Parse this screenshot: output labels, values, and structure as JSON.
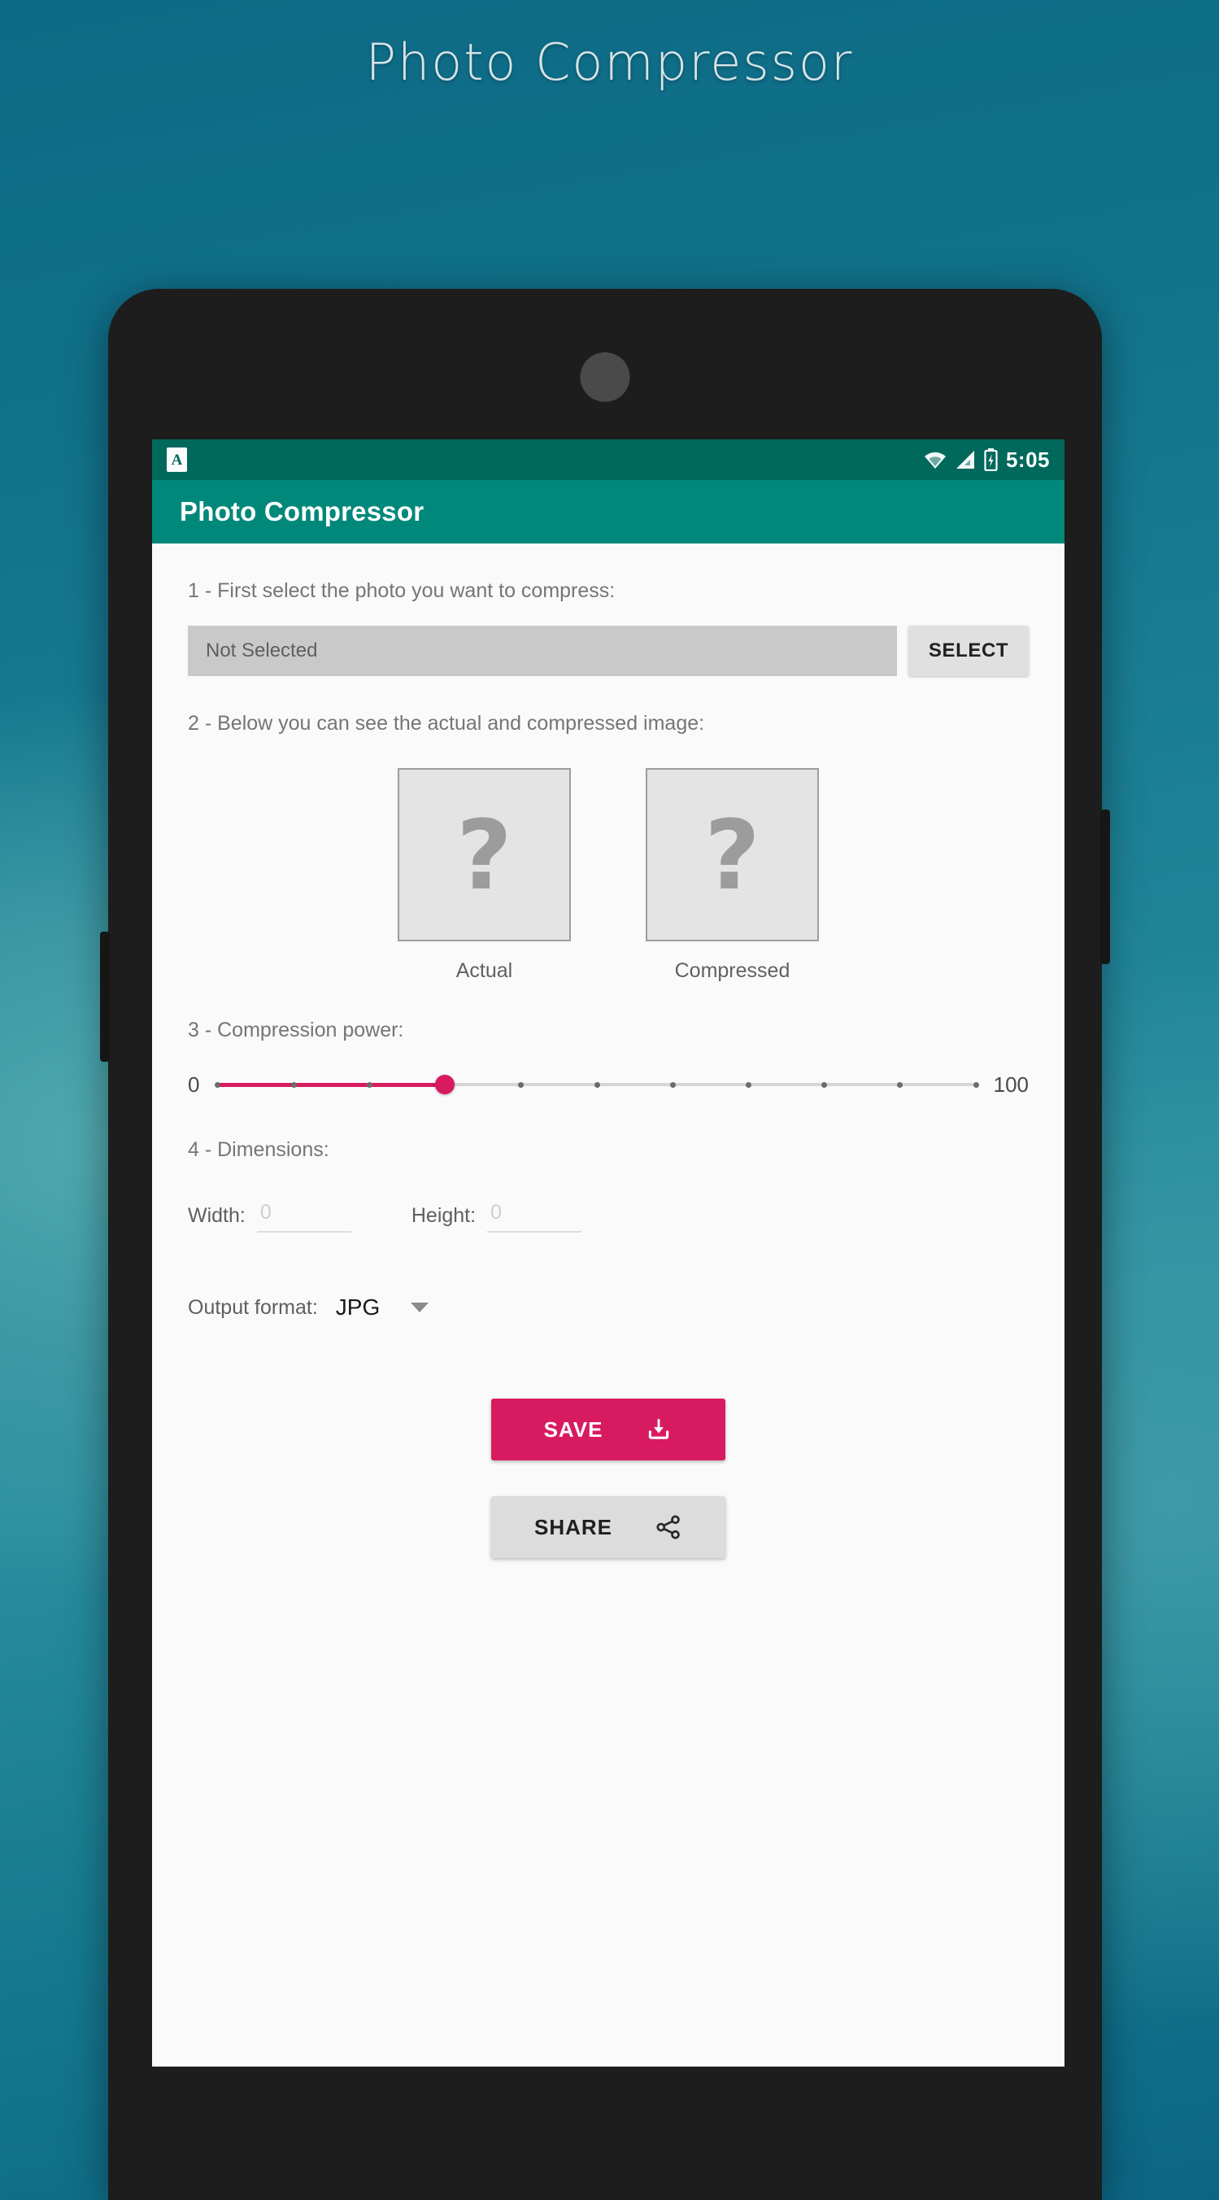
{
  "page": {
    "title": "Photo Compressor"
  },
  "phone": {
    "status_bar": {
      "app_icon": "app-notification-icon",
      "wifi_icon": "wifi-icon",
      "signal_icon": "cellular-signal-icon",
      "battery_icon": "battery-charging-icon",
      "time": "5:05"
    },
    "app_bar": {
      "title": "Photo Compressor"
    }
  },
  "steps": {
    "step1_label": "1 - First select the photo you want to compress:",
    "step2_label": "2 - Below you can see the actual and compressed image:",
    "step3_label": "3 - Compression power:",
    "step4_label": "4 - Dimensions:"
  },
  "select_row": {
    "file_value": "Not Selected",
    "file_placeholder": "Not Selected",
    "button_label": "SELECT"
  },
  "previews": [
    {
      "caption": "Actual",
      "placeholder_glyph": "?"
    },
    {
      "caption": "Compressed",
      "placeholder_glyph": "?"
    }
  ],
  "slider": {
    "min_label": "0",
    "max_label": "100",
    "min": 0,
    "max": 100,
    "value": 30,
    "tick_count": 11,
    "fill_color": "#d81b60",
    "track_color": "#d6d6d6"
  },
  "dimensions": {
    "width_label": "Width:",
    "width_value": "",
    "width_placeholder": "0",
    "height_label": "Height:",
    "height_value": "",
    "height_placeholder": "0"
  },
  "output_format": {
    "label": "Output format:",
    "selected": "JPG",
    "caret_icon": "chevron-down-icon"
  },
  "actions": {
    "save_label": "SAVE",
    "save_icon": "download-icon",
    "save_color": "#d81b60",
    "share_label": "SHARE",
    "share_icon": "share-icon",
    "share_color": "#dcdcdc"
  },
  "theme": {
    "app_bar_color": "#00887a",
    "status_bar_color": "#00695c",
    "accent_color": "#d81b60",
    "screen_background": "#fafafa"
  }
}
